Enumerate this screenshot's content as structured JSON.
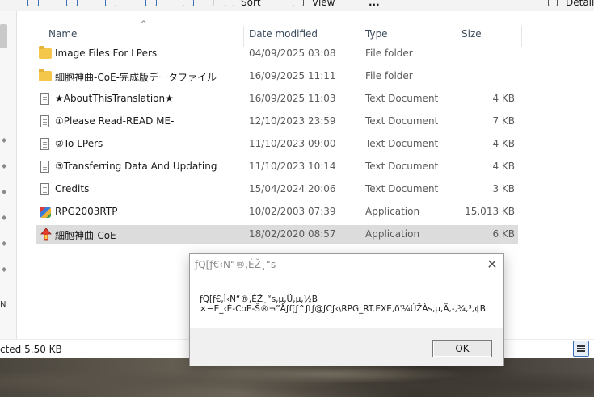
{
  "toolbar": {
    "sort_label": "Sort",
    "view_label": "View",
    "more_label": "...",
    "details_label": "Details"
  },
  "columns": {
    "name": "Name",
    "date_modified": "Date modified",
    "type": "Type",
    "size": "Size"
  },
  "files": [
    {
      "name": "Image Files For LPers",
      "date": "04/09/2025 03:08",
      "type": "File folder",
      "size": "",
      "icon": "folder-icon"
    },
    {
      "name": "細胞神曲-CoE-完成版データファイル",
      "date": "16/09/2025 11:11",
      "type": "File folder",
      "size": "",
      "icon": "folder-icon"
    },
    {
      "name": "★AboutThisTranslation★",
      "date": "16/09/2025 11:03",
      "type": "Text Document",
      "size": "4 KB",
      "icon": "text-document-icon"
    },
    {
      "name": "①Please Read-READ ME-",
      "date": "12/10/2023 23:59",
      "type": "Text Document",
      "size": "7 KB",
      "icon": "text-document-icon"
    },
    {
      "name": "②To LPers",
      "date": "11/10/2023 09:00",
      "type": "Text Document",
      "size": "4 KB",
      "icon": "text-document-icon"
    },
    {
      "name": "③Transferring Data And Updating",
      "date": "11/10/2023 10:14",
      "type": "Text Document",
      "size": "4 KB",
      "icon": "text-document-icon"
    },
    {
      "name": "Credits",
      "date": "15/04/2024 20:06",
      "type": "Text Document",
      "size": "3 KB",
      "icon": "text-document-icon"
    },
    {
      "name": "RPG2003RTP",
      "date": "10/02/2003 07:39",
      "type": "Application",
      "size": "15,013 KB",
      "icon": "application-icon"
    },
    {
      "name": "細胞神曲-CoE-",
      "date": "18/02/2020 08:57",
      "type": "Application",
      "size": "6 KB",
      "icon": "game-arrow-icon",
      "selected": true
    }
  ],
  "status": {
    "selected_text": "cted  5.50 KB"
  },
  "nav": {
    "partial_letter": "N"
  },
  "dialog": {
    "title": "ƒQ[ƒ€‹N“®,ÉŽ¸“s",
    "message_line1": "ƒQ[ƒ€,Ì‹N“®,ÉŽ¸“s,µ,Ü,µ,½B",
    "message_line2": "×−E_‹É-CoE-Š®¬”Åƒf[ƒ^ƒtƒ@ƒCƒ‹\\RPG_RT.EXE,ð'¼ÚŽÀs,µ,Ä,-,¾,³,¢B",
    "ok_label": "OK",
    "close_glyph": "✕"
  },
  "colors": {
    "accent": "#3b6fb6",
    "selected_row": "#dcdcdc",
    "folder": "#f4c74a"
  }
}
